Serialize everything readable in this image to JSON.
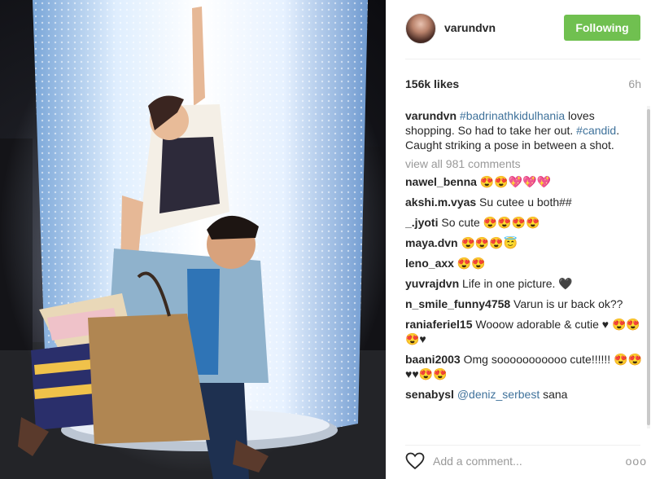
{
  "post": {
    "photo_alt": "",
    "header": {
      "username": "varundvn",
      "follow_label": "Following"
    },
    "stats": {
      "likes": "156k likes",
      "time": "6h"
    },
    "caption": {
      "user": "varundvn",
      "parts": [
        {
          "type": "tag",
          "text": "#badrinathkidulhania"
        },
        {
          "type": "text",
          "text": " loves shopping. So had to take her out. "
        },
        {
          "type": "tag",
          "text": "#candid"
        },
        {
          "type": "text",
          "text": ". Caught striking a pose in between a shot."
        }
      ]
    },
    "view_all": "view all 981 comments",
    "comments": [
      {
        "user": "nawel_benna",
        "text": " 😍😍💖💖💖"
      },
      {
        "user": "akshi.m.vyas",
        "text": " Su cutee u both##"
      },
      {
        "user": "_.jyoti",
        "text": " So cute 😍😍😍😍"
      },
      {
        "user": "maya.dvn",
        "text": " 😍😍😍😇"
      },
      {
        "user": "leno_axx",
        "text": " 😍😍"
      },
      {
        "user": "yuvrajdvn",
        "text": " Life in one picture. 🖤"
      },
      {
        "user": "n_smile_funny4758",
        "text": " Varun is ur back ok??"
      },
      {
        "user": "raniaferiel15",
        "text": " Wooow adorable & cutie ♥ 😍😍😍♥"
      },
      {
        "user": "baani2003",
        "text": " Omg sooooooooooo cute!!!!!! 😍😍♥♥😍😍"
      },
      {
        "user": "senabysl",
        "text": " ",
        "tag": "@deniz_serbest",
        "after": " sana"
      }
    ],
    "footer": {
      "comment_placeholder": "Add a comment...",
      "more_label": "ooo",
      "heart_icon": "heart-outline-icon"
    }
  }
}
